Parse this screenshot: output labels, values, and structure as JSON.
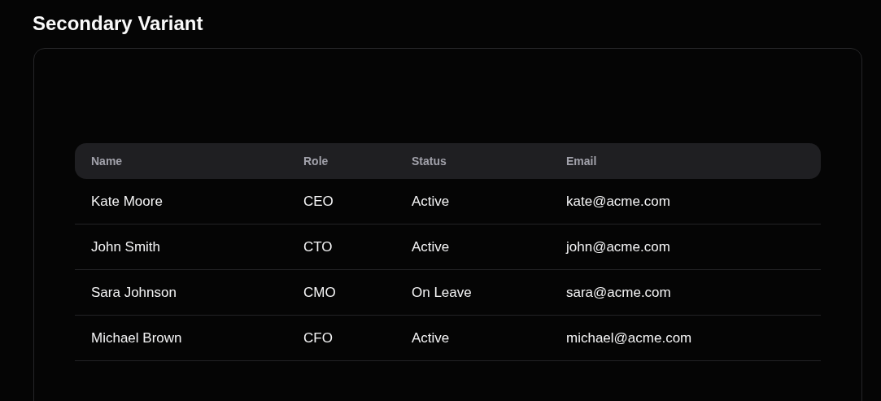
{
  "title": "Secondary Variant",
  "table": {
    "columns": [
      "Name",
      "Role",
      "Status",
      "Email"
    ],
    "rows": [
      [
        "Kate Moore",
        "CEO",
        "Active",
        "kate@acme.com"
      ],
      [
        "John Smith",
        "CTO",
        "Active",
        "john@acme.com"
      ],
      [
        "Sara Johnson",
        "CMO",
        "On Leave",
        "sara@acme.com"
      ],
      [
        "Michael Brown",
        "CFO",
        "Active",
        "michael@acme.com"
      ]
    ]
  }
}
